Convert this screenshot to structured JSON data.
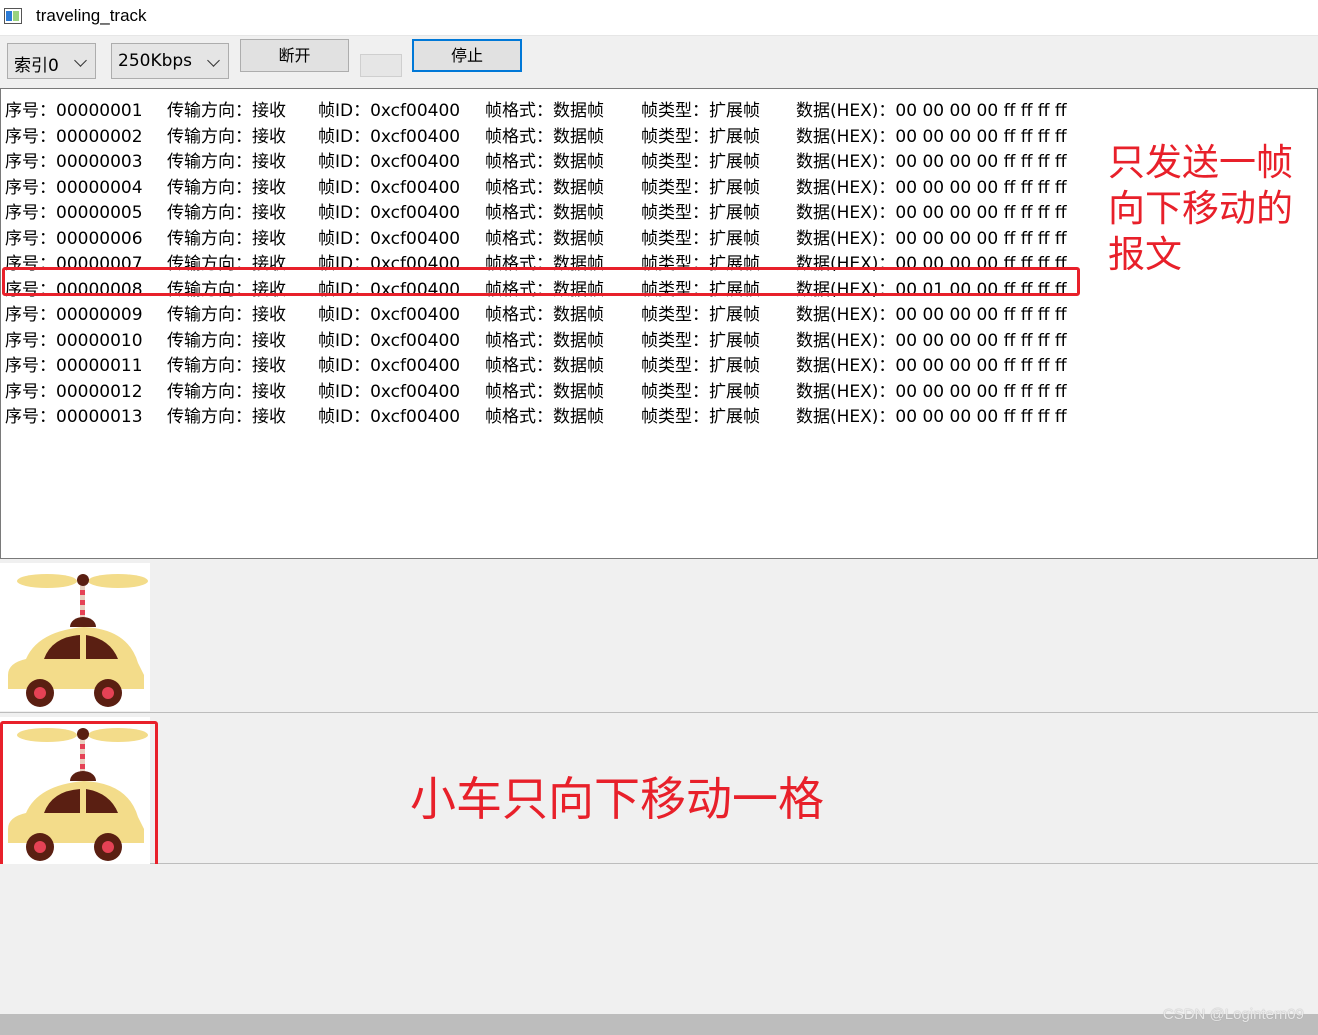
{
  "window": {
    "title": "traveling_track"
  },
  "toolbar": {
    "index_combo": "索引0",
    "baud_combo": "250Kbps",
    "disconnect_label": "断开",
    "stop_label": "停止"
  },
  "log_rows": [
    {
      "seq": "序号：00000001",
      "dir": "传输方向：接收",
      "id": "帧ID：0xcf00400",
      "fmt": "帧格式：数据帧",
      "type": "帧类型：扩展帧",
      "data": "数据(HEX)：00 00 00 00 ff ff ff ff"
    },
    {
      "seq": "序号：00000002",
      "dir": "传输方向：接收",
      "id": "帧ID：0xcf00400",
      "fmt": "帧格式：数据帧",
      "type": "帧类型：扩展帧",
      "data": "数据(HEX)：00 00 00 00 ff ff ff ff"
    },
    {
      "seq": "序号：00000003",
      "dir": "传输方向：接收",
      "id": "帧ID：0xcf00400",
      "fmt": "帧格式：数据帧",
      "type": "帧类型：扩展帧",
      "data": "数据(HEX)：00 00 00 00 ff ff ff ff"
    },
    {
      "seq": "序号：00000004",
      "dir": "传输方向：接收",
      "id": "帧ID：0xcf00400",
      "fmt": "帧格式：数据帧",
      "type": "帧类型：扩展帧",
      "data": "数据(HEX)：00 00 00 00 ff ff ff ff"
    },
    {
      "seq": "序号：00000005",
      "dir": "传输方向：接收",
      "id": "帧ID：0xcf00400",
      "fmt": "帧格式：数据帧",
      "type": "帧类型：扩展帧",
      "data": "数据(HEX)：00 00 00 00 ff ff ff ff"
    },
    {
      "seq": "序号：00000006",
      "dir": "传输方向：接收",
      "id": "帧ID：0xcf00400",
      "fmt": "帧格式：数据帧",
      "type": "帧类型：扩展帧",
      "data": "数据(HEX)：00 00 00 00 ff ff ff ff"
    },
    {
      "seq": "序号：00000007",
      "dir": "传输方向：接收",
      "id": "帧ID：0xcf00400",
      "fmt": "帧格式：数据帧",
      "type": "帧类型：扩展帧",
      "data": "数据(HEX)：00 00 00 00 ff ff ff ff"
    },
    {
      "seq": "序号：00000008",
      "dir": "传输方向：接收",
      "id": "帧ID：0xcf00400",
      "fmt": "帧格式：数据帧",
      "type": "帧类型：扩展帧",
      "data": "数据(HEX)：00 01 00 00 ff ff ff ff"
    },
    {
      "seq": "序号：00000009",
      "dir": "传输方向：接收",
      "id": "帧ID：0xcf00400",
      "fmt": "帧格式：数据帧",
      "type": "帧类型：扩展帧",
      "data": "数据(HEX)：00 00 00 00 ff ff ff ff"
    },
    {
      "seq": "序号：00000010",
      "dir": "传输方向：接收",
      "id": "帧ID：0xcf00400",
      "fmt": "帧格式：数据帧",
      "type": "帧类型：扩展帧",
      "data": "数据(HEX)：00 00 00 00 ff ff ff ff"
    },
    {
      "seq": "序号：00000011",
      "dir": "传输方向：接收",
      "id": "帧ID：0xcf00400",
      "fmt": "帧格式：数据帧",
      "type": "帧类型：扩展帧",
      "data": "数据(HEX)：00 00 00 00 ff ff ff ff"
    },
    {
      "seq": "序号：00000012",
      "dir": "传输方向：接收",
      "id": "帧ID：0xcf00400",
      "fmt": "帧格式：数据帧",
      "type": "帧类型：扩展帧",
      "data": "数据(HEX)：00 00 00 00 ff ff ff ff"
    },
    {
      "seq": "序号：00000013",
      "dir": "传输方向：接收",
      "id": "帧ID：0xcf00400",
      "fmt": "帧格式：数据帧",
      "type": "帧类型：扩展帧",
      "data": "数据(HEX)：00 00 00 00 ff ff ff ff"
    }
  ],
  "annotations": {
    "log_note": "只发送一帧向下移动的报文",
    "car_note": "小车只向下移动一格"
  },
  "colors": {
    "annotation_red": "#e8202a",
    "car_body": "#f3dc8a",
    "car_dark": "#5a1f12",
    "wheel_red": "#e54255"
  },
  "icons": {
    "car": "helicopter-car-icon"
  },
  "watermark": "CSDN @Logintern09"
}
